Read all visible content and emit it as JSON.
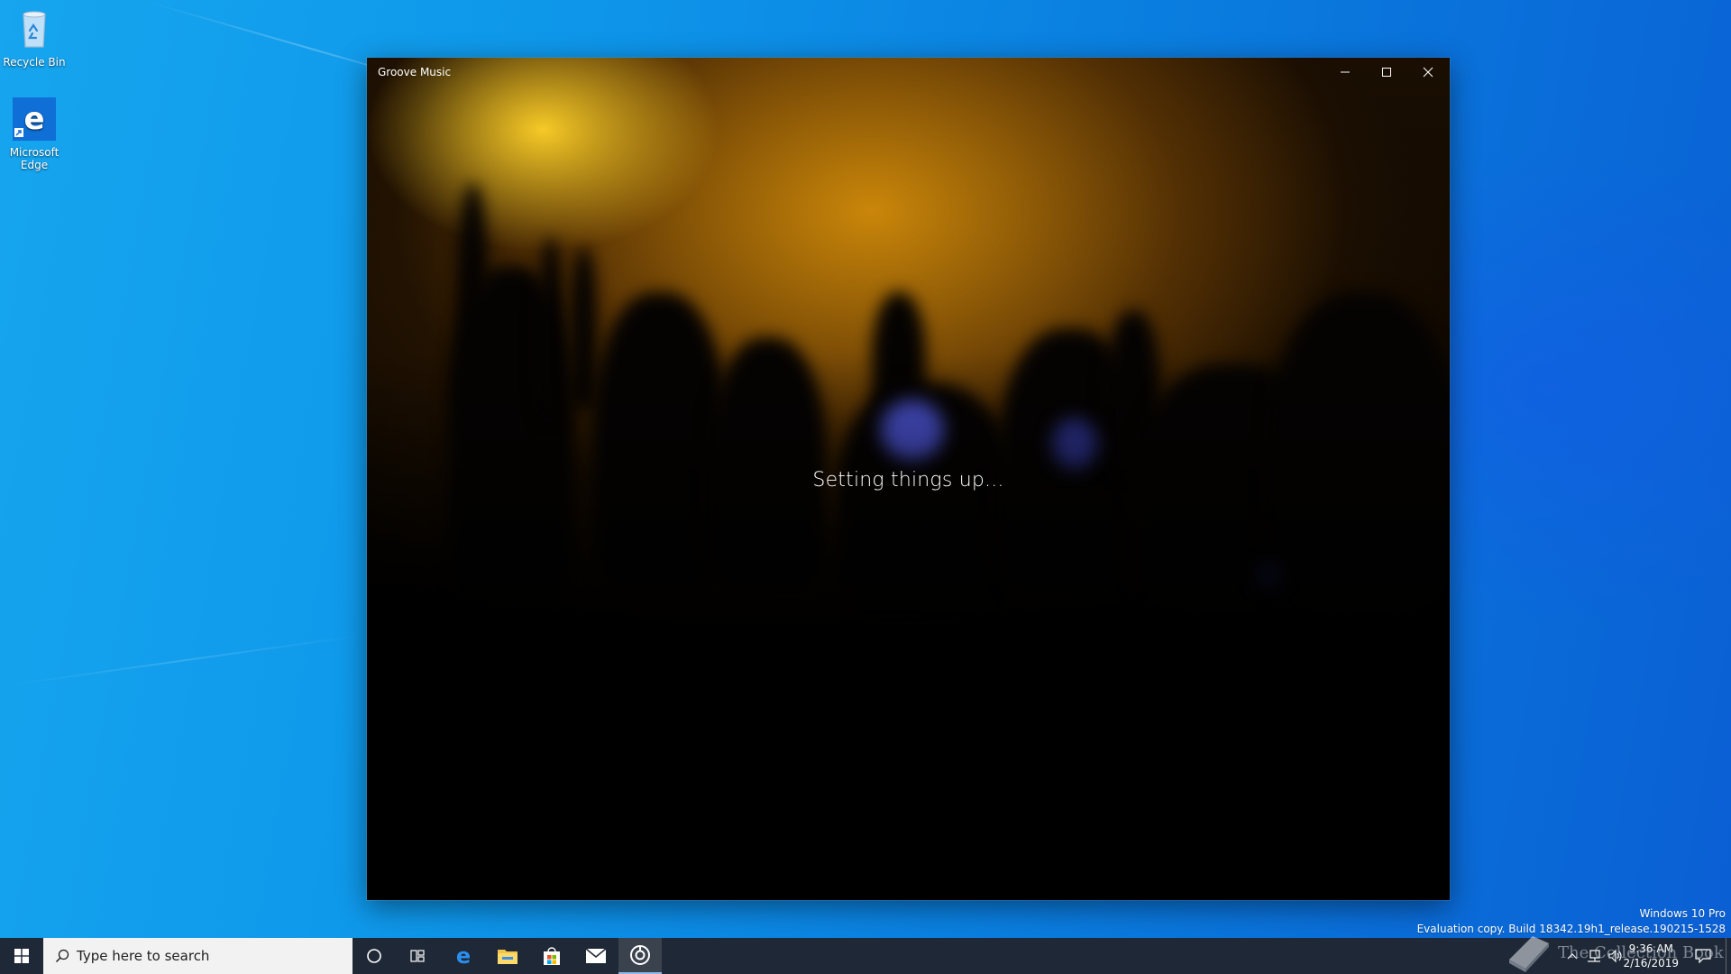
{
  "desktop": {
    "icons": [
      {
        "label": "Recycle Bin"
      },
      {
        "label": "Microsoft Edge"
      }
    ]
  },
  "window": {
    "title": "Groove Music",
    "status_text": "Setting things up...",
    "controls": {
      "minimize": "minimize",
      "maximize": "maximize",
      "close": "close"
    }
  },
  "watermark": {
    "line1": "Windows 10 Pro",
    "line2": "Evaluation copy. Build 18342.19h1_release.190215-1528",
    "brand": "The Collection Book"
  },
  "taskbar": {
    "search_placeholder": "Type here to search",
    "pinned": [
      "cortana-icon",
      "task-view-icon",
      "edge-icon",
      "file-explorer-icon",
      "store-icon",
      "mail-icon",
      "groove-music-icon"
    ],
    "active_app": "groove-music-icon",
    "clock_time": "9:36 AM",
    "clock_date": "2/16/2019"
  },
  "colors": {
    "taskbar_bg": "#1f2836",
    "desktop_blue": "#0e97ea",
    "window_bg": "#000000",
    "accent_gold": "#e0a010"
  }
}
